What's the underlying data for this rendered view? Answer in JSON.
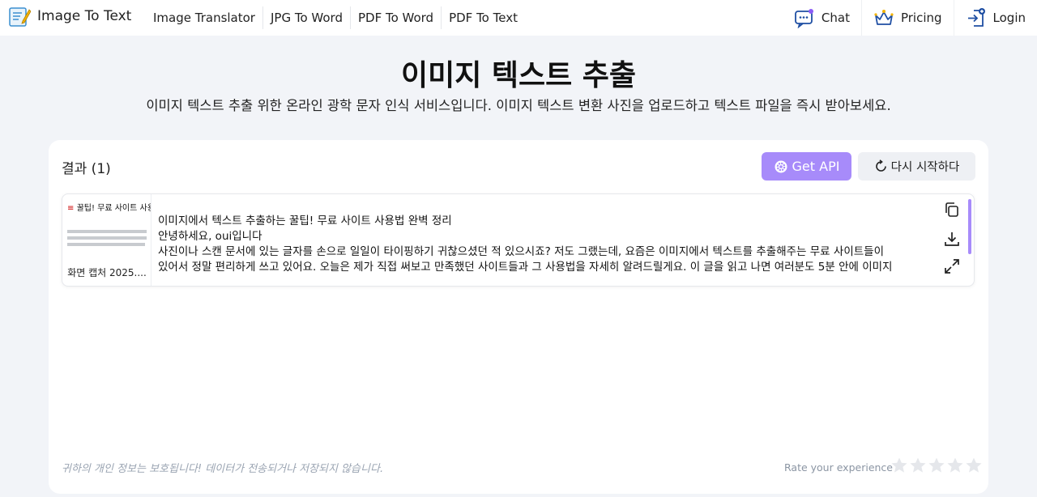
{
  "header": {
    "logo_text": "Image To Text",
    "nav": [
      "Image Translator",
      "JPG To Word",
      "PDF To Word",
      "PDF To Text"
    ],
    "chat_label": "Chat",
    "pricing_label": "Pricing",
    "login_label": "Login"
  },
  "hero": {
    "title": "이미지 텍스트 추출",
    "subtitle": "이미지 텍스트 추출 위한 온라인 광학 문자 인식 서비스입니다. 이미지 텍스트 변환 사진을 업로드하고 텍스트 파일을 즉시 받아보세요."
  },
  "results": {
    "title": "결과 (1)",
    "get_api_label": "Get API",
    "restart_label": "다시 시작하다",
    "item": {
      "thumb_heading": "꿀팁! 무료 사이트 사용",
      "thumb_caption": "화면 캡처 2025....",
      "text_lines": [
        "이미지에서 텍스트 추출하는 꿀팁! 무료 사이트 사용법 완벽 정리",
        "안녕하세요, oui입니다",
        "사진이나 스캔 문서에 있는 글자를 손으로 일일이 타이핑하기 귀찮으셨던 적 있으시죠? 저도 그랬는데, 요즘은 이미지에서 텍스트를 추출해주는 무료 사이트들이",
        "있어서 정말 편리하게 쓰고 있어요. 오늘은 제가 직접 써보고 만족했던 사이트들과 그 사용법을 자세히 알려드릴게요. 이 글을 읽고 나면 여러분도 5분 안에 이미지"
      ]
    }
  },
  "footer": {
    "privacy": "귀하의 개인 정보는 보호됩니다! 데이터가 전송되거나 저장되지 않습니다.",
    "rate_label": "Rate your experience"
  },
  "colors": {
    "accent": "#a78bfa",
    "background": "#f2f4f8",
    "star": "#e5e7eb"
  }
}
